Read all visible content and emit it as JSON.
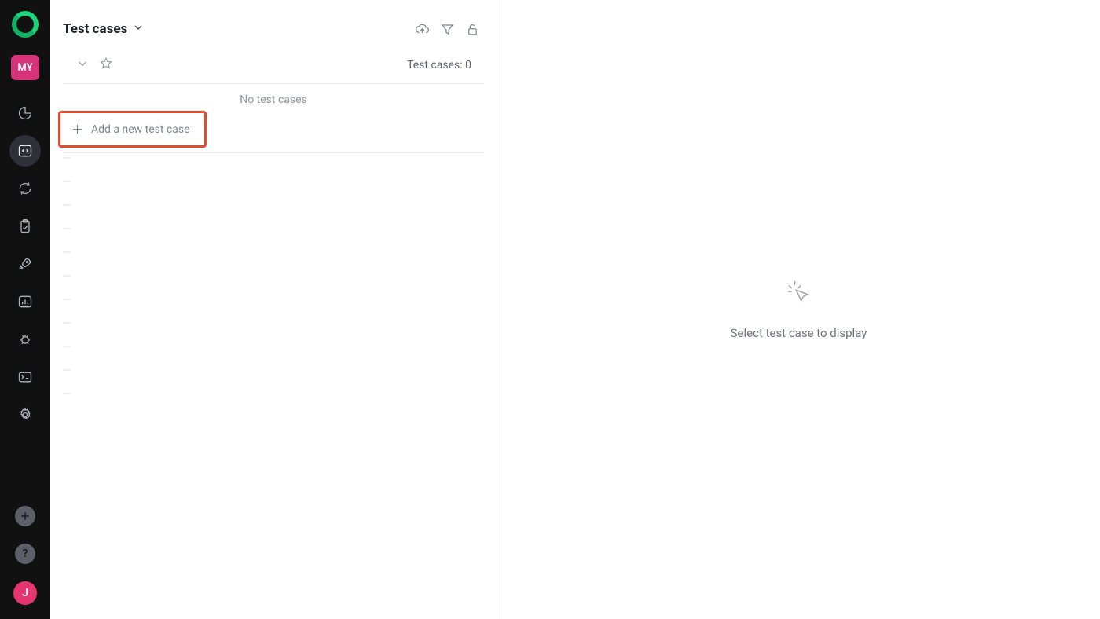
{
  "sidebar": {
    "project_abbrev": "MY",
    "user_initial": "J"
  },
  "header": {
    "title": "Test cases"
  },
  "list": {
    "count_label": "Test cases: 0",
    "empty_message": "No test cases",
    "add_label": "Add a new test case"
  },
  "detail": {
    "placeholder": "Select test case to display"
  }
}
